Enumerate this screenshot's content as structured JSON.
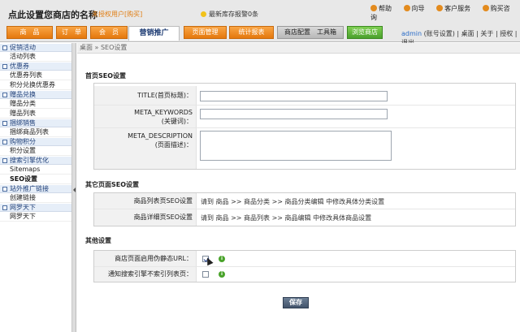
{
  "header": {
    "site_name": "点此设置您商店的名称",
    "license": "未授权用户[购买]",
    "notice": "最新库存报警0条",
    "top_links": [
      "帮助",
      "向导",
      "客户服务",
      "购买咨询"
    ]
  },
  "nav": {
    "tabs": [
      {
        "label": "商　品",
        "style": "orange"
      },
      {
        "label": "订　单",
        "style": "orange"
      },
      {
        "label": "会　员",
        "style": "orange"
      },
      {
        "label": "营销推广",
        "style": "active"
      },
      {
        "label": "页面管理",
        "style": "orange"
      },
      {
        "label": "统计报表",
        "style": "orange"
      },
      {
        "label": "商店配置　工具箱",
        "style": "gray"
      },
      {
        "label": "浏览商店",
        "style": "green"
      }
    ],
    "user": "admin",
    "user_links": "(账号设置) | 桌面 | 关于 | 授权 | 退出"
  },
  "sidebar": {
    "groups": [
      {
        "title": "促销活动",
        "items": [
          "活动列表"
        ]
      },
      {
        "title": "优惠券",
        "items": [
          "优惠券列表",
          "积分兑换优惠券"
        ]
      },
      {
        "title": "赠品兑换",
        "items": [
          "赠品分类",
          "赠品列表"
        ]
      },
      {
        "title": "捆绑销售",
        "items": [
          "捆绑商品列表"
        ]
      },
      {
        "title": "购物积分",
        "items": [
          "积分设置"
        ]
      },
      {
        "title": "搜索引擎优化",
        "items": [
          "Sitemaps",
          "SEO设置"
        ]
      },
      {
        "title": "站外推广链接",
        "items": [
          "创建链接"
        ]
      },
      {
        "title": "网罗天下",
        "items": [
          "网罗天下"
        ]
      }
    ],
    "active_item": "SEO设置"
  },
  "breadcrumb": "桌面 » SEO设置",
  "sections": {
    "home_title": "首页SEO设置",
    "other_title": "其它页面SEO设置",
    "misc_title": "其他设置"
  },
  "home_fields": {
    "title_label": "TITLE(首页标题)：",
    "keywords_label": "META_KEYWORDS",
    "keywords_sub": "(关键词)：",
    "description_label": "META_DESCRIPTION",
    "description_sub": "(页面描述)："
  },
  "other_rows": [
    {
      "label": "商品列表页SEO设置",
      "value": "请到 商品 >> 商品分类 >> 商品分类编辑 中修改具体分类设置"
    },
    {
      "label": "商品详细页SEO设置",
      "value": "请到 商品 >> 商品列表 >> 商品编辑 中修改具体商品设置"
    }
  ],
  "misc_rows": [
    {
      "label": "商店页面启用伪静态URL：",
      "checked": true
    },
    {
      "label": "通知搜索引擎不索引列表页：",
      "checked": false
    }
  ],
  "info_icon_glyph": "i",
  "save_label": "保存"
}
